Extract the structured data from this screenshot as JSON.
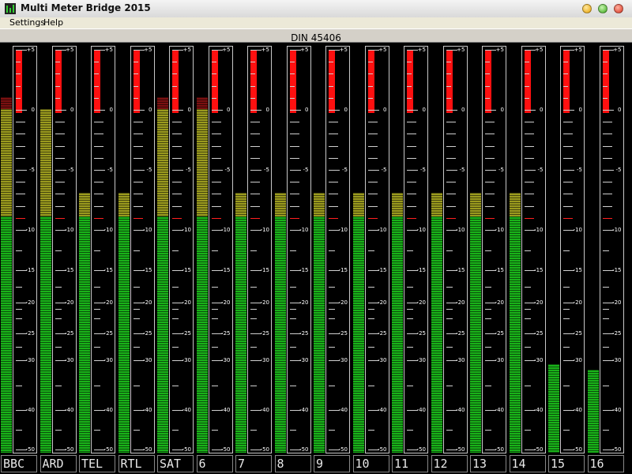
{
  "window": {
    "title": "Multi Meter Bridge 2015"
  },
  "menu": {
    "items": [
      {
        "label": "Settings"
      },
      {
        "label": "Help"
      }
    ]
  },
  "standard": "DIN 45406",
  "scale": {
    "labels": [
      "+5",
      "0",
      "-5",
      "-10",
      "-15",
      "-20",
      "-25",
      "-30",
      "-40",
      "-50"
    ],
    "values": [
      5,
      0,
      -5,
      -10,
      -15,
      -20,
      -25,
      -30,
      -40,
      -50
    ]
  },
  "colors": {
    "green": "#19b219",
    "yellow": "#9a9a1e",
    "darkred": "#7a1010",
    "red": "#ff1010",
    "background": "#000000"
  },
  "channels": [
    {
      "label": "BBC",
      "level_db": 1
    },
    {
      "label": "ARD",
      "level_db": 0
    },
    {
      "label": "TEL",
      "level_db": -7
    },
    {
      "label": "RTL",
      "level_db": -7
    },
    {
      "label": "SAT",
      "level_db": 1
    },
    {
      "label": "6",
      "level_db": 1
    },
    {
      "label": "7",
      "level_db": -7
    },
    {
      "label": "8",
      "level_db": -7
    },
    {
      "label": "9",
      "level_db": -7
    },
    {
      "label": "10",
      "level_db": -7
    },
    {
      "label": "11",
      "level_db": -7
    },
    {
      "label": "12",
      "level_db": -7
    },
    {
      "label": "13",
      "level_db": -7
    },
    {
      "label": "14",
      "level_db": -7
    },
    {
      "label": "15",
      "level_db": -31
    },
    {
      "label": "16",
      "level_db": -32
    }
  ]
}
